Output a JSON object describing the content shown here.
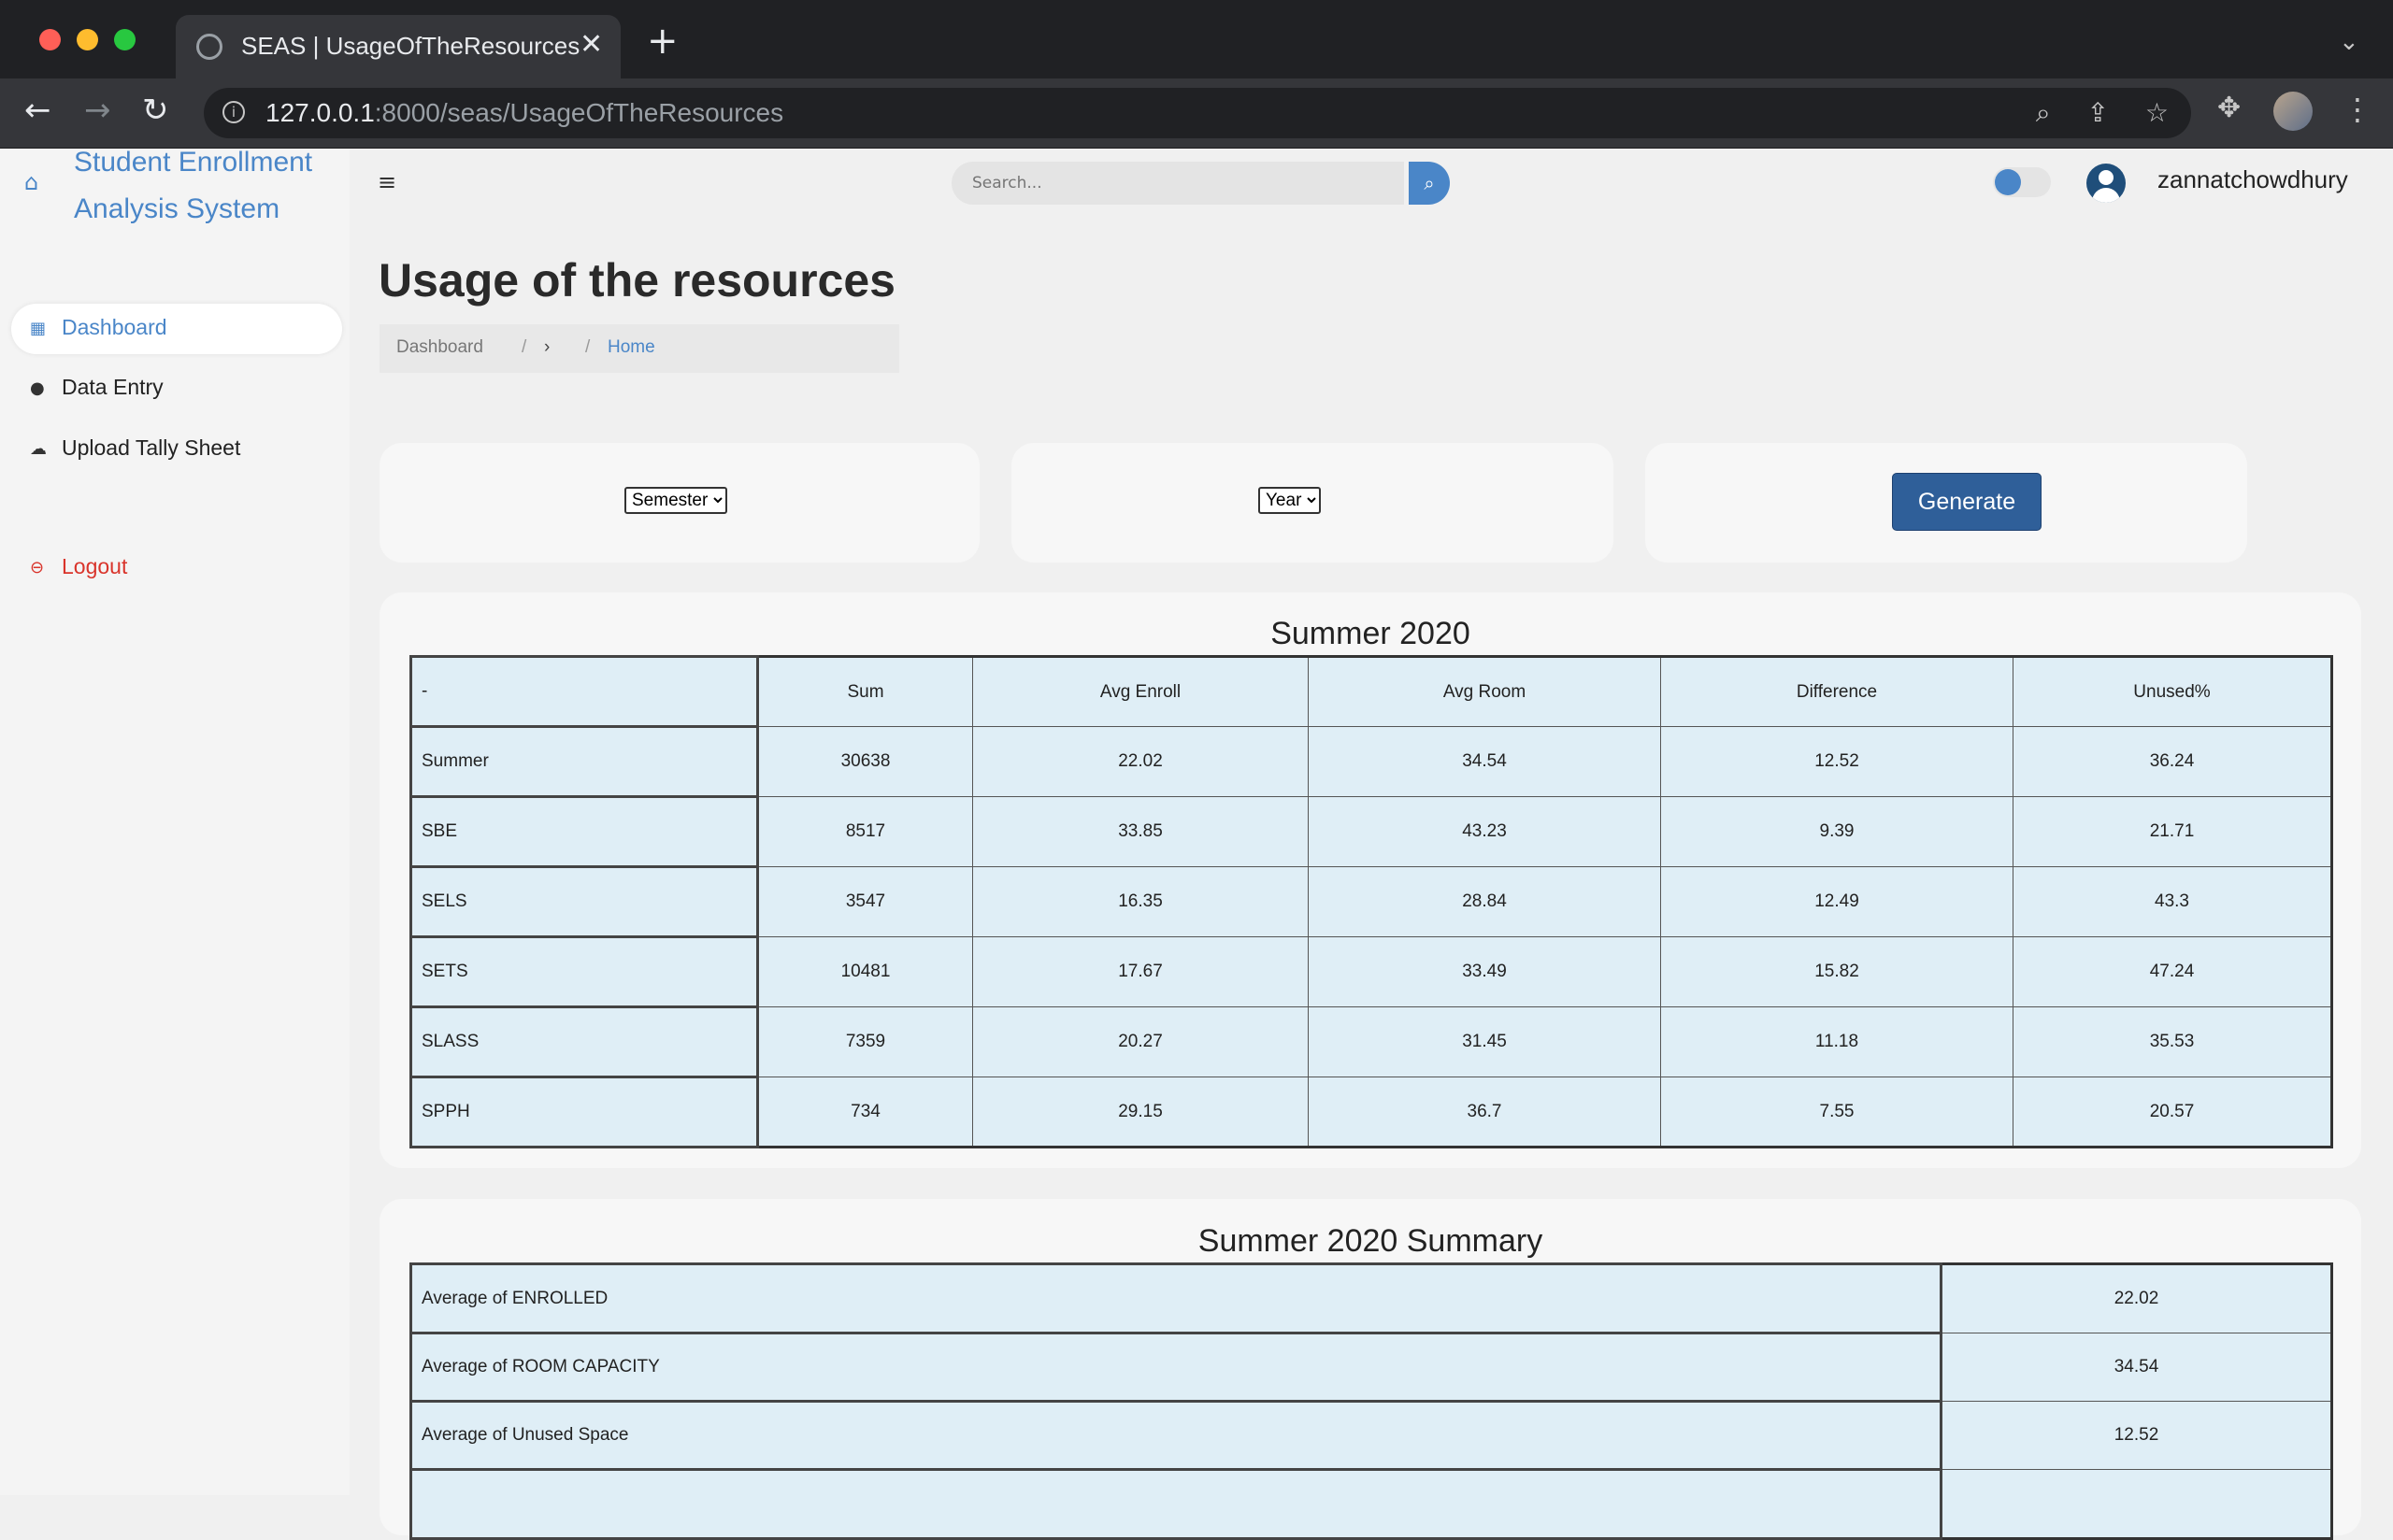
{
  "browser": {
    "tab_title": "SEAS | UsageOfTheResources",
    "url_host": "127.0.0.1",
    "url_rest": ":8000/seas/UsageOfTheResources"
  },
  "sidebar": {
    "brand_line1": "Student Enrollment",
    "brand_line2": "Analysis System",
    "items": [
      {
        "label": "Dashboard",
        "icon": "grid-icon"
      },
      {
        "label": "Data Entry",
        "icon": "user-icon"
      },
      {
        "label": "Upload Tally Sheet",
        "icon": "cloud-upload-icon"
      },
      {
        "label": "Logout",
        "icon": "logout-icon"
      }
    ]
  },
  "topbar": {
    "search_placeholder": "Search...",
    "username": "zannatchowdhury"
  },
  "page": {
    "title": "Usage of the resources",
    "breadcrumb": [
      "Dashboard",
      "/",
      "›",
      "/",
      "Home"
    ]
  },
  "filters": {
    "semester_label": "Semester",
    "year_label": "Year",
    "generate_label": "Generate"
  },
  "table1": {
    "title": "Summer 2020",
    "headers": [
      "-",
      "Sum",
      "Avg Enroll",
      "Avg Room",
      "Difference",
      "Unused%"
    ],
    "rows": [
      [
        "Summer",
        "30638",
        "22.02",
        "34.54",
        "12.52",
        "36.24"
      ],
      [
        "SBE",
        "8517",
        "33.85",
        "43.23",
        "9.39",
        "21.71"
      ],
      [
        "SELS",
        "3547",
        "16.35",
        "28.84",
        "12.49",
        "43.3"
      ],
      [
        "SETS",
        "10481",
        "17.67",
        "33.49",
        "15.82",
        "47.24"
      ],
      [
        "SLASS",
        "7359",
        "20.27",
        "31.45",
        "11.18",
        "35.53"
      ],
      [
        "SPPH",
        "734",
        "29.15",
        "36.7",
        "7.55",
        "20.57"
      ]
    ]
  },
  "table2": {
    "title": "Summer 2020 Summary",
    "rows": [
      [
        "Average of ENROLLED",
        "22.02"
      ],
      [
        "Average of ROOM CAPACITY",
        "34.54"
      ],
      [
        "Average of Unused Space",
        "12.52"
      ],
      [
        "",
        ""
      ]
    ]
  },
  "colors": {
    "accent": "#4a86c8",
    "button": "#2f5f99",
    "table_bg": "#dfeef6",
    "logout": "#d9342b"
  }
}
